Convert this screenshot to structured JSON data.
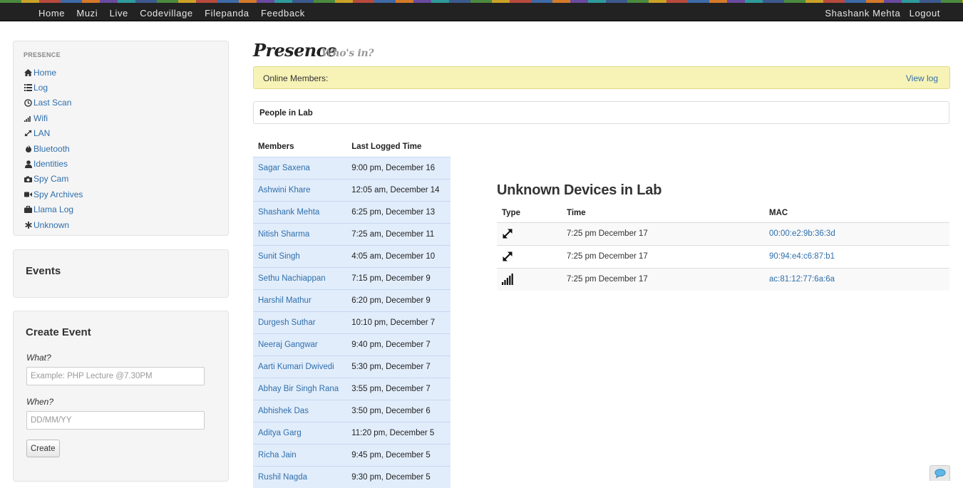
{
  "topnav": {
    "left": [
      "Home",
      "Muzi",
      "Live",
      "Codevillage",
      "Filepanda",
      "Feedback"
    ],
    "user": "Shashank Mehta",
    "logout": "Logout"
  },
  "sidebar": {
    "header": "PRESENCE",
    "items": [
      {
        "label": "Home",
        "icon": "home-icon"
      },
      {
        "label": "Log",
        "icon": "list-icon"
      },
      {
        "label": "Last Scan",
        "icon": "clock-icon"
      },
      {
        "label": "Wifi",
        "icon": "signal-icon"
      },
      {
        "label": "LAN",
        "icon": "resize-icon"
      },
      {
        "label": "Bluetooth",
        "icon": "fire-icon"
      },
      {
        "label": "Identities",
        "icon": "user-icon"
      },
      {
        "label": "Spy Cam",
        "icon": "camera-icon"
      },
      {
        "label": "Spy Archives",
        "icon": "video-icon"
      },
      {
        "label": "Llama Log",
        "icon": "briefcase-icon"
      },
      {
        "label": "Unknown",
        "icon": "asterisk-icon"
      }
    ],
    "events_title": "Events",
    "create": {
      "title": "Create Event",
      "what_label": "What?",
      "what_placeholder": "Example: PHP Lecture @7.30PM",
      "when_label": "When?",
      "when_placeholder": "DD/MM/YY",
      "button": "Create"
    }
  },
  "main": {
    "title": "Presence",
    "subtitle": "Who's in?",
    "online_label": "Online Members:",
    "view_log": "View log",
    "people_title": "People in Lab",
    "members_headers": [
      "Members",
      "Last Logged Time"
    ],
    "members": [
      {
        "name": "Sagar Saxena",
        "time": "9:00 pm, December 16"
      },
      {
        "name": "Ashwini Khare",
        "time": "12:05 am, December 14"
      },
      {
        "name": "Shashank Mehta",
        "time": "6:25 pm, December 13"
      },
      {
        "name": "Nitish Sharma",
        "time": "7:25 am, December 11"
      },
      {
        "name": "Sunit Singh",
        "time": "4:05 am, December 10"
      },
      {
        "name": "Sethu Nachiappan",
        "time": "7:15 pm, December 9"
      },
      {
        "name": "Harshil Mathur",
        "time": "6:20 pm, December 9"
      },
      {
        "name": "Durgesh Suthar",
        "time": "10:10 pm, December 7"
      },
      {
        "name": "Neeraj Gangwar",
        "time": "9:40 pm, December 7"
      },
      {
        "name": "Aarti Kumari Dwivedi",
        "time": "5:30 pm, December 7"
      },
      {
        "name": "Abhay Bir Singh Rana",
        "time": "3:55 pm, December 7"
      },
      {
        "name": "Abhishek Das",
        "time": "3:50 pm, December 6"
      },
      {
        "name": "Aditya Garg",
        "time": "11:20 pm, December 5"
      },
      {
        "name": "Richa Jain",
        "time": "9:45 pm, December 5"
      },
      {
        "name": "Rushil Nagda",
        "time": "9:30 pm, December 5"
      }
    ],
    "unknown_title": "Unknown Devices in Lab",
    "devices_headers": [
      "Type",
      "Time",
      "MAC"
    ],
    "devices": [
      {
        "type": "lan-icon",
        "time": "7:25 pm December 17",
        "mac": "00:00:e2:9b:36:3d"
      },
      {
        "type": "lan-icon",
        "time": "7:25 pm December 17",
        "mac": "90:94:e4:c6:87:b1"
      },
      {
        "type": "wifi-signal-icon",
        "time": "7:25 pm December 17",
        "mac": "ac:81:12:77:6a:6a"
      }
    ]
  }
}
